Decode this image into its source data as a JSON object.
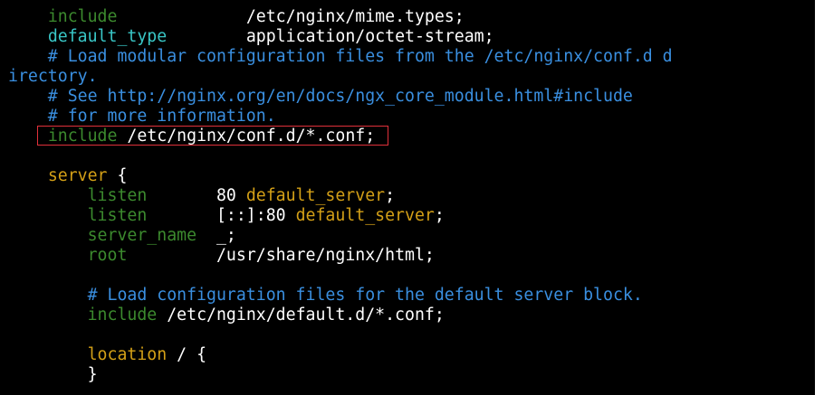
{
  "terminal": {
    "lines": [
      {
        "segments": [
          {
            "text": "    ",
            "color": "#ffffff"
          },
          {
            "text": "include",
            "color": "#3c8a2e"
          },
          {
            "text": "             /etc/nginx/mime.types;",
            "color": "#ffffff"
          }
        ]
      },
      {
        "segments": [
          {
            "text": "    ",
            "color": "#ffffff"
          },
          {
            "text": "default_type",
            "color": "#39c6c6"
          },
          {
            "text": "        application/octet-stream;",
            "color": "#ffffff"
          }
        ]
      },
      {
        "segments": [
          {
            "text": "    # Load modular configuration files from the /etc/nginx/conf.d d",
            "color": "#3a8fe0"
          }
        ]
      },
      {
        "segments": [
          {
            "text": "irectory.",
            "color": "#3a8fe0"
          }
        ]
      },
      {
        "segments": [
          {
            "text": "    # See http://nginx.org/en/docs/ngx_core_module.html#include",
            "color": "#3a8fe0"
          }
        ]
      },
      {
        "segments": [
          {
            "text": "    # for more information.",
            "color": "#3a8fe0"
          }
        ]
      },
      {
        "segments": [
          {
            "text": "    ",
            "color": "#ffffff"
          },
          {
            "text": "include",
            "color": "#3c8a2e"
          },
          {
            "text": " /etc/nginx/conf.d/*.conf;",
            "color": "#ffffff"
          }
        ]
      },
      {
        "segments": [
          {
            "text": "",
            "color": "#ffffff"
          }
        ]
      },
      {
        "segments": [
          {
            "text": "    ",
            "color": "#ffffff"
          },
          {
            "text": "server",
            "color": "#d4a017"
          },
          {
            "text": " {",
            "color": "#ffffff"
          }
        ]
      },
      {
        "segments": [
          {
            "text": "        ",
            "color": "#ffffff"
          },
          {
            "text": "listen",
            "color": "#3c8a2e"
          },
          {
            "text": "       80 ",
            "color": "#ffffff"
          },
          {
            "text": "default_server",
            "color": "#d4a017"
          },
          {
            "text": ";",
            "color": "#ffffff"
          }
        ]
      },
      {
        "segments": [
          {
            "text": "        ",
            "color": "#ffffff"
          },
          {
            "text": "listen",
            "color": "#3c8a2e"
          },
          {
            "text": "       [::]:80 ",
            "color": "#ffffff"
          },
          {
            "text": "default_server",
            "color": "#d4a017"
          },
          {
            "text": ";",
            "color": "#ffffff"
          }
        ]
      },
      {
        "segments": [
          {
            "text": "        ",
            "color": "#ffffff"
          },
          {
            "text": "server_name",
            "color": "#3c8a2e"
          },
          {
            "text": "  _;",
            "color": "#ffffff"
          }
        ]
      },
      {
        "segments": [
          {
            "text": "        ",
            "color": "#ffffff"
          },
          {
            "text": "root",
            "color": "#3c8a2e"
          },
          {
            "text": "         /usr/share/nginx/html;",
            "color": "#ffffff"
          }
        ]
      },
      {
        "segments": [
          {
            "text": "",
            "color": "#ffffff"
          }
        ]
      },
      {
        "segments": [
          {
            "text": "        # Load configuration files for the default server block.",
            "color": "#3a8fe0"
          }
        ]
      },
      {
        "segments": [
          {
            "text": "        ",
            "color": "#ffffff"
          },
          {
            "text": "include",
            "color": "#3c8a2e"
          },
          {
            "text": " /etc/nginx/default.d/*.conf;",
            "color": "#ffffff"
          }
        ]
      },
      {
        "segments": [
          {
            "text": "",
            "color": "#ffffff"
          }
        ]
      },
      {
        "segments": [
          {
            "text": "        ",
            "color": "#ffffff"
          },
          {
            "text": "location",
            "color": "#d4a017"
          },
          {
            "text": " / {",
            "color": "#ffffff"
          }
        ]
      },
      {
        "segments": [
          {
            "text": "        }",
            "color": "#ffffff"
          }
        ]
      }
    ],
    "highlighted_line": 6,
    "colors": {
      "background": "#000000",
      "default_text": "#ffffff",
      "directive": "#3c8a2e",
      "cyan_directive": "#39c6c6",
      "comment": "#3a8fe0",
      "keyword": "#d4a017",
      "highlight_border": "#e0303a"
    }
  }
}
